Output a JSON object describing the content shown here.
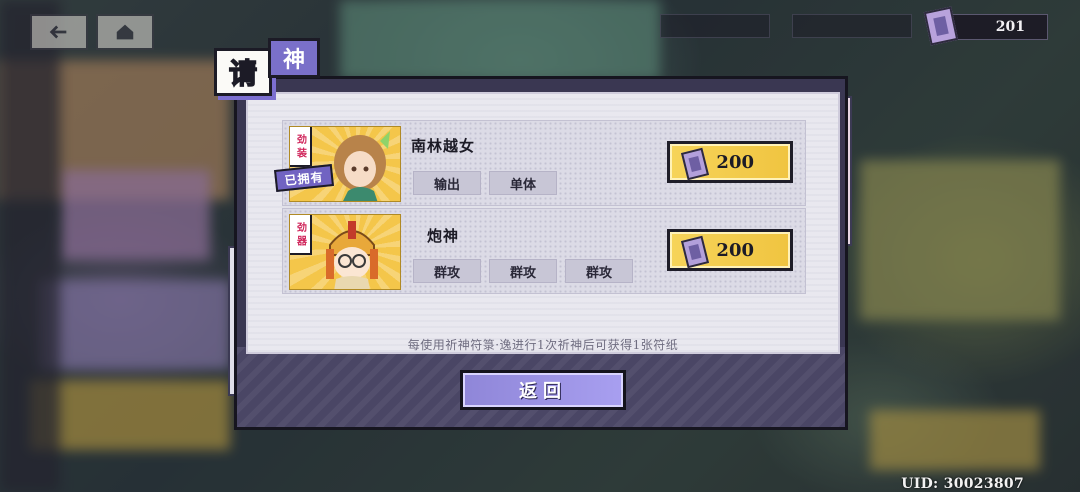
{
  "currency": {
    "amount": "201",
    "icon": "ticket-icon"
  },
  "title": {
    "char1": "请",
    "char2": "神"
  },
  "cards": [
    {
      "name": "南林越女",
      "side_tag": "劲 装",
      "owned_label": "已拥有",
      "skills": [
        "输出",
        "单体"
      ],
      "price": "200",
      "portrait_icon": "character-portrait-brown-hair-girl"
    },
    {
      "name": "炮神",
      "side_tag": "劲 器",
      "owned_label": "",
      "skills": [
        "群攻",
        "群攻",
        "群攻"
      ],
      "price": "200",
      "portrait_icon": "character-portrait-helmet-glasses"
    }
  ],
  "note": "每使用祈神符箓·逸进行1次祈神后可获得1张符纸",
  "return_label": "返回",
  "uid": "UID:  30023807",
  "colors": {
    "accent_purple": "#7a70c9",
    "price_yellow": "#f6d45a",
    "dark_outline": "#1c1b26"
  }
}
